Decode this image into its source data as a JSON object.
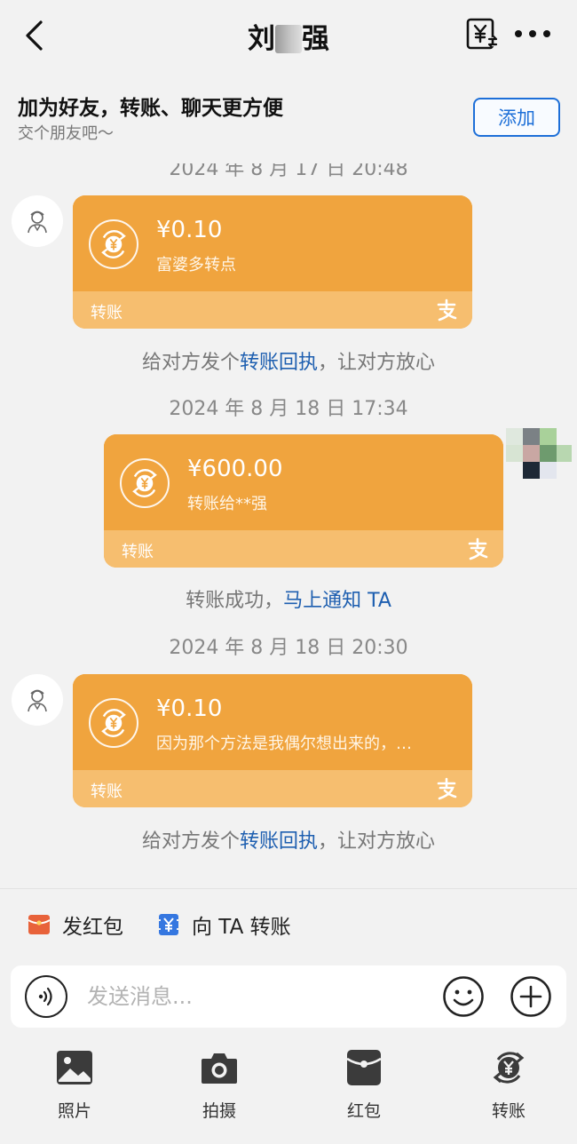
{
  "header": {
    "title_left": "刘",
    "title_right": "强"
  },
  "banner": {
    "title": "加为好友，转账、聊天更方便",
    "subtitle": "交个朋友吧～",
    "add_label": "添加"
  },
  "chat": {
    "partial_timestamp": "2024 年 8 月 17 日 20:48",
    "messages": [
      {
        "amount": "¥0.10",
        "memo": "富婆多转点",
        "label": "转账",
        "note_prefix": "给对方发个",
        "note_link": "转账回执",
        "note_suffix": "，让对方放心"
      },
      {
        "timestamp": "2024 年 8 月 18 日 17:34",
        "amount": "¥600.00",
        "memo": "转账给**强",
        "label": "转账",
        "note_prefix": "转账成功，",
        "note_link": "马上通知 TA"
      },
      {
        "timestamp": "2024 年 8 月 18 日 20:30",
        "amount": "¥0.10",
        "memo": "因为那个方法是我偶尔想出来的，…",
        "label": "转账",
        "note_prefix": "给对方发个",
        "note_link": "转账回执",
        "note_suffix": "，让对方放心"
      }
    ]
  },
  "quick_actions": {
    "red_packet": "发红包",
    "transfer": "向 TA 转账"
  },
  "input": {
    "placeholder": "发送消息..."
  },
  "tools": [
    {
      "label": "照片",
      "icon": "photo-icon"
    },
    {
      "label": "拍摄",
      "icon": "camera-icon"
    },
    {
      "label": "红包",
      "icon": "red-packet-icon"
    },
    {
      "label": "转账",
      "icon": "transfer-icon"
    }
  ],
  "colors": {
    "card_top": "#f0a43e",
    "card_bottom": "#f6be6f",
    "link": "#1e5fb0",
    "add_button": "#1d6fd8",
    "background": "#f2f2f2"
  }
}
